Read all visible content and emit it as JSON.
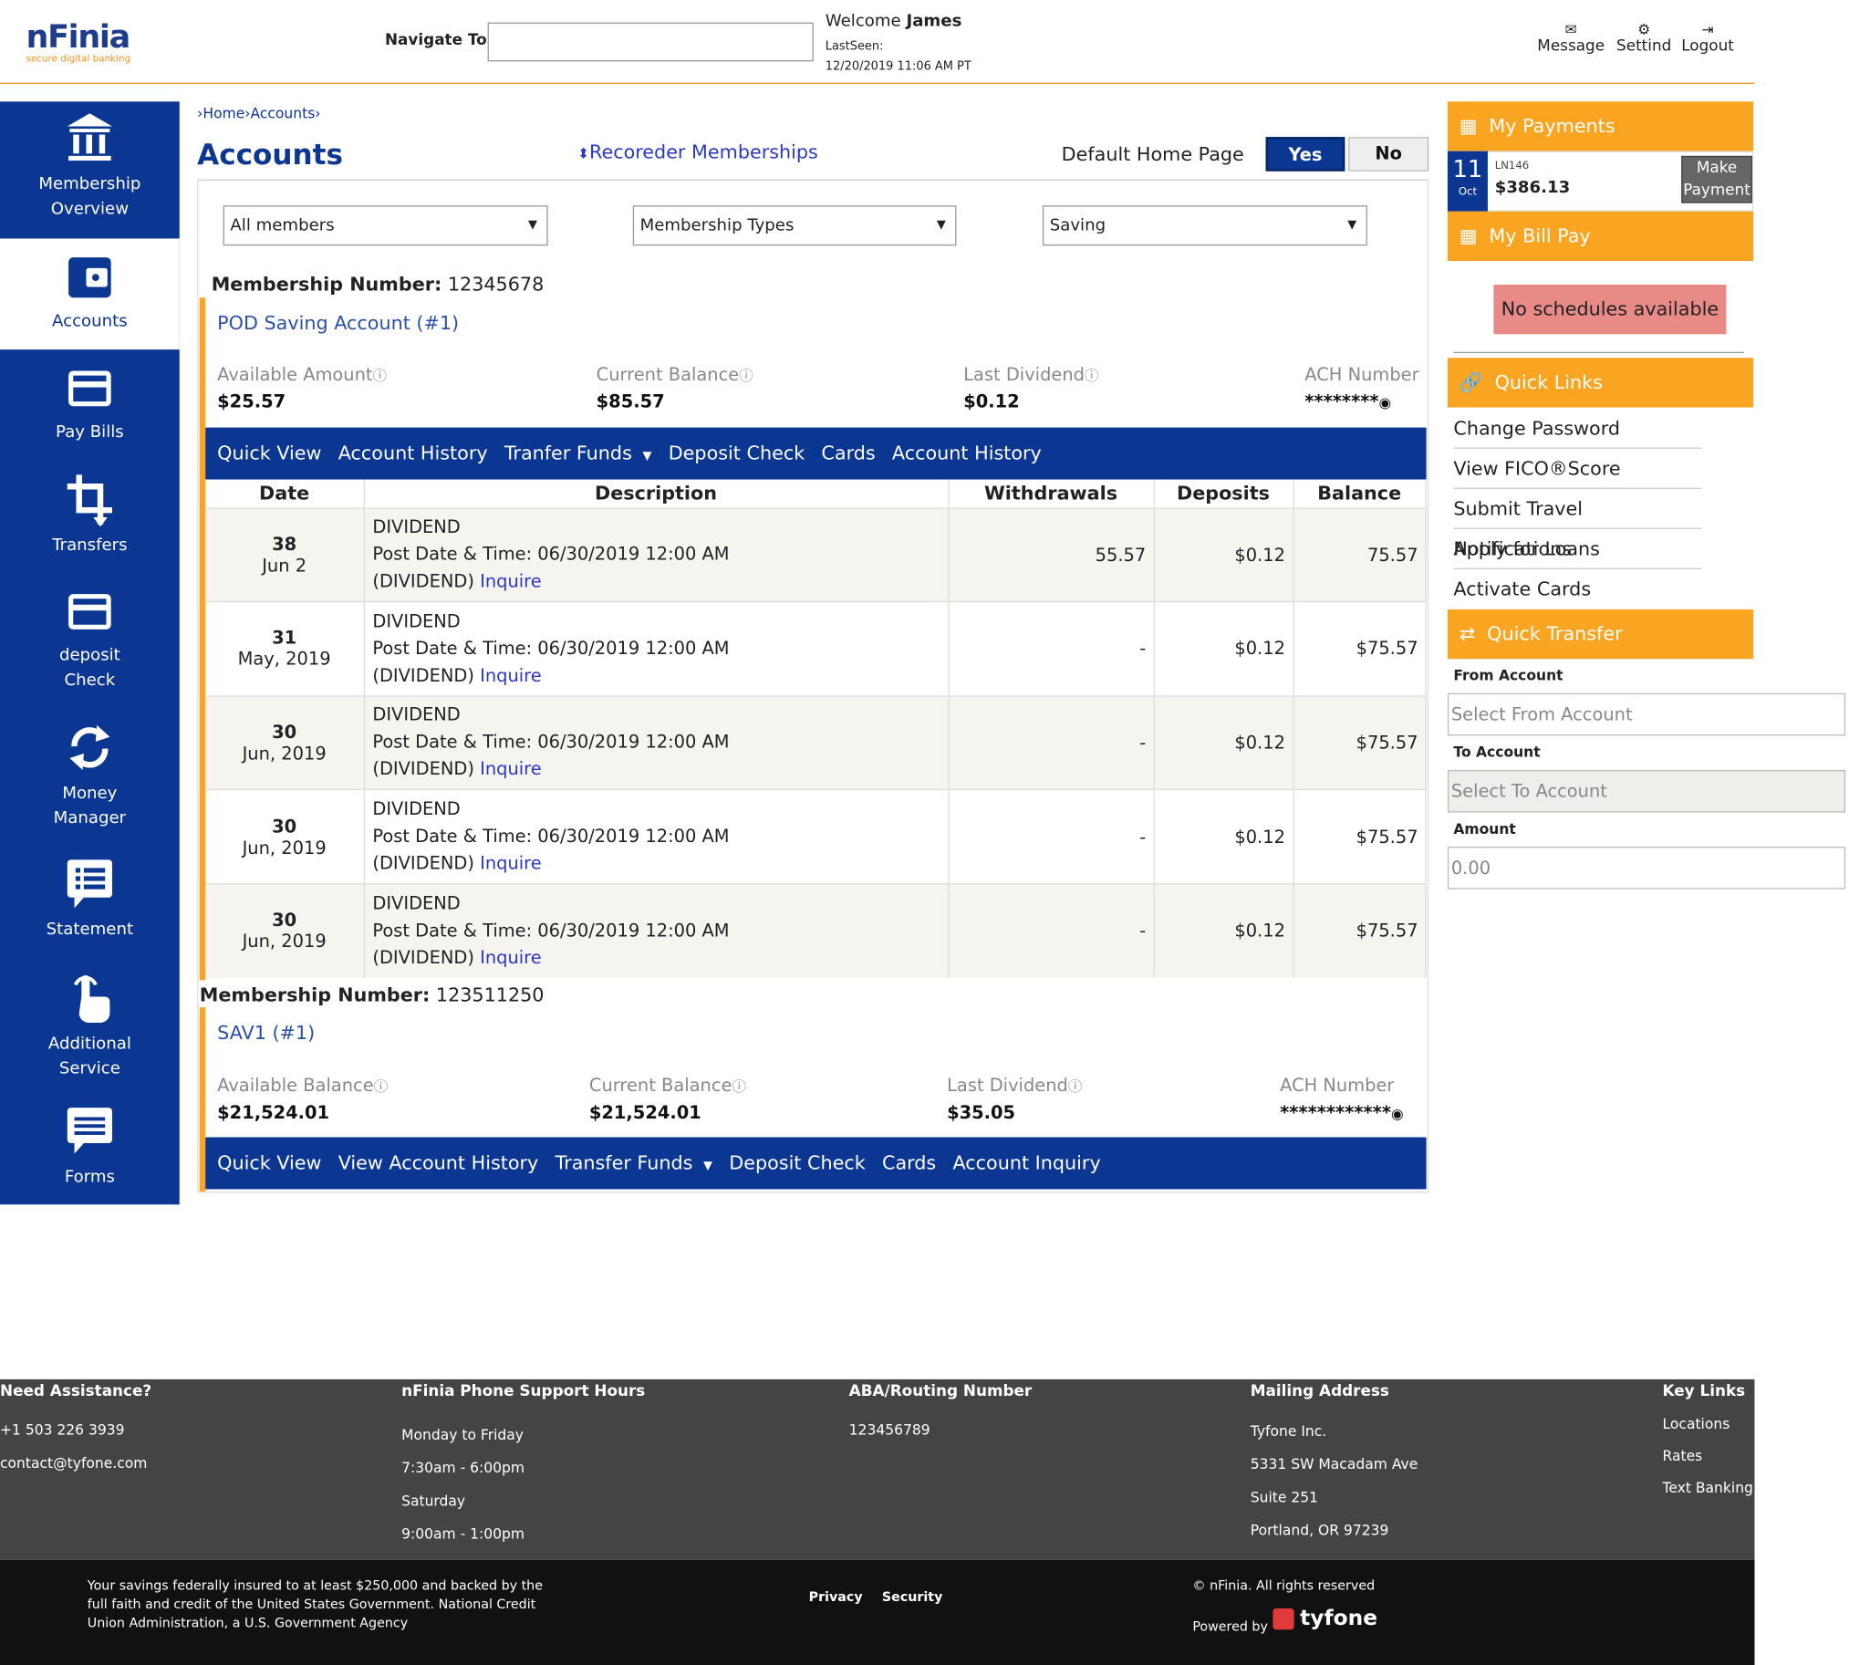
{
  "header": {
    "logo": "nFinia",
    "logo_tagline": "secure digital banking",
    "navigate_label": "Navigate To:",
    "welcome_prefix": "Welcome",
    "user_name": "James",
    "lastseen_label": "LastSeen:",
    "lastseen_value": "12/20/2019 11:06 AM PT",
    "message_label": "Message",
    "settings_label": "Settind",
    "logout_label": "Logout"
  },
  "sidebar": {
    "items": [
      {
        "label": "Membership Overview",
        "icon": "bank-icon"
      },
      {
        "label": "Accounts",
        "icon": "wallet-icon"
      },
      {
        "label": "Pay Bills",
        "icon": "card-icon"
      },
      {
        "label": "Transfers",
        "icon": "crop-icon"
      },
      {
        "label": "deposit Check",
        "icon": "card-icon"
      },
      {
        "label": "Money Manager",
        "icon": "sync-icon"
      },
      {
        "label": "Statement",
        "icon": "list-icon"
      },
      {
        "label": "Additional Service",
        "icon": "touch-icon"
      },
      {
        "label": "Forms",
        "icon": "message-icon"
      }
    ]
  },
  "main": {
    "breadcrumb_home": "Home",
    "breadcrumb_accounts": "Accounts",
    "title": "Accounts",
    "reorder": "Recoreder Memberships",
    "default_home_label": "Default Home Page",
    "yes": "Yes",
    "no": "No",
    "filters": {
      "members": "All members",
      "types": "Membership Types",
      "saving": "Saving"
    },
    "membership_label": "Membership Number:",
    "membership1": {
      "number": "12345678",
      "account_name": "POD Saving Account (#1)",
      "available_label": "Available Amount",
      "available": "$25.57",
      "current_label": "Current Balance",
      "current": "$85.57",
      "dividend_label": "Last Dividend",
      "dividend": "$0.12",
      "ach_label": "ACH Number",
      "ach": "********",
      "actions": [
        "Quick View",
        "Account History",
        "Tranfer Funds",
        "Deposit Check",
        "Cards",
        "Account History"
      ]
    },
    "table": {
      "headers": {
        "date": "Date",
        "description": "Description",
        "withdrawals": "Withdrawals",
        "deposits": "Deposits",
        "balance": "Balance"
      },
      "post_label": "Post Date & Time: 06/30/2019 12:00 AM",
      "inquire": "Inquire",
      "rows": [
        {
          "day": "38",
          "month": "Jun 2",
          "type": "DIVIDEND",
          "paren": "(DIVIDEND)",
          "withdrawal": "55.57",
          "deposit": "$0.12",
          "balance": "75.57"
        },
        {
          "day": "31",
          "month": "May, 2019",
          "type": "DIVIDEND",
          "paren": "(DIVIDEND)",
          "withdrawal": "-",
          "deposit": "$0.12",
          "balance": "$75.57"
        },
        {
          "day": "30",
          "month": "Jun, 2019",
          "type": "DIVIDEND",
          "paren": "(DIVIDEND)",
          "withdrawal": "-",
          "deposit": "$0.12",
          "balance": "$75.57"
        },
        {
          "day": "30",
          "month": "Jun, 2019",
          "type": "DIVIDEND",
          "paren": "(DIVIDEND)",
          "withdrawal": "-",
          "deposit": "$0.12",
          "balance": "$75.57"
        },
        {
          "day": "30",
          "month": "Jun, 2019",
          "type": "DIVIDEND",
          "paren": "(DIVIDEND)",
          "withdrawal": "-",
          "deposit": "$0.12",
          "balance": "$75.57"
        }
      ]
    },
    "membership2": {
      "number": "123511250",
      "account_name": "SAV1 (#1)",
      "available_label": "Available Balance",
      "available": "$21,524.01",
      "current_label": "Current Balance",
      "current": "$21,524.01",
      "dividend_label": "Last Dividend",
      "dividend": "$35.05",
      "ach_label": "ACH Number",
      "ach": "************",
      "actions": [
        "Quick View",
        "View Account History",
        "Transfer Funds",
        "Deposit Check",
        "Cards",
        "Account Inquiry"
      ]
    }
  },
  "right": {
    "my_payments": "My Payments",
    "pay_day": "11",
    "pay_month": "Oct",
    "pay_id": "LN146",
    "pay_amount": "$386.13",
    "make_payment": "Make Payment",
    "my_bill_pay": "My Bill Pay",
    "no_schedules": "No schedules available",
    "quick_links": "Quick Links",
    "links": [
      "Change Password",
      "View FICO®Score",
      "Submit Travel Notifications",
      "Apply for Loans",
      "Activate Cards"
    ],
    "quick_transfer": "Quick Transfer",
    "from_label": "From Account",
    "from_placeholder": "Select From Account",
    "to_label": "To Account",
    "to_placeholder": "Select To Account",
    "amount_label": "Amount",
    "amount_value": "0.00"
  },
  "footer": {
    "assist_h": "Need Assistance?",
    "phone": "+1 503 226 3939",
    "email": "contact@tyfone.com",
    "hours_h": "nFinia Phone Support Hours",
    "hours": [
      "Monday to Friday",
      "7:30am - 6:00pm",
      "Saturday",
      "9:00am - 1:00pm"
    ],
    "aba_h": "ABA/Routing Number",
    "aba": "123456789",
    "mail_h": "Mailing Address",
    "mail": [
      "Tyfone Inc.",
      "5331 SW Macadam Ave",
      "Suite 251",
      "Portland, OR 97239"
    ],
    "key_h": "Key Links",
    "keys": [
      "Locations",
      "Rates",
      "Text Banking"
    ],
    "insured": "Your savings federally insured to at least $250,000 and backed by the full faith and credit of the United States Government. National Credit Union Administration, a U.S. Government Agency",
    "privacy": "Privacy",
    "security": "Security",
    "copyright": "© nFinia. All rights reserved",
    "powered": "Powered by",
    "brand": "tyfone"
  },
  "colors": {
    "primary": "#0b3792",
    "accent": "#f9a521",
    "alert": "#e88a86",
    "footer": "#444444"
  }
}
